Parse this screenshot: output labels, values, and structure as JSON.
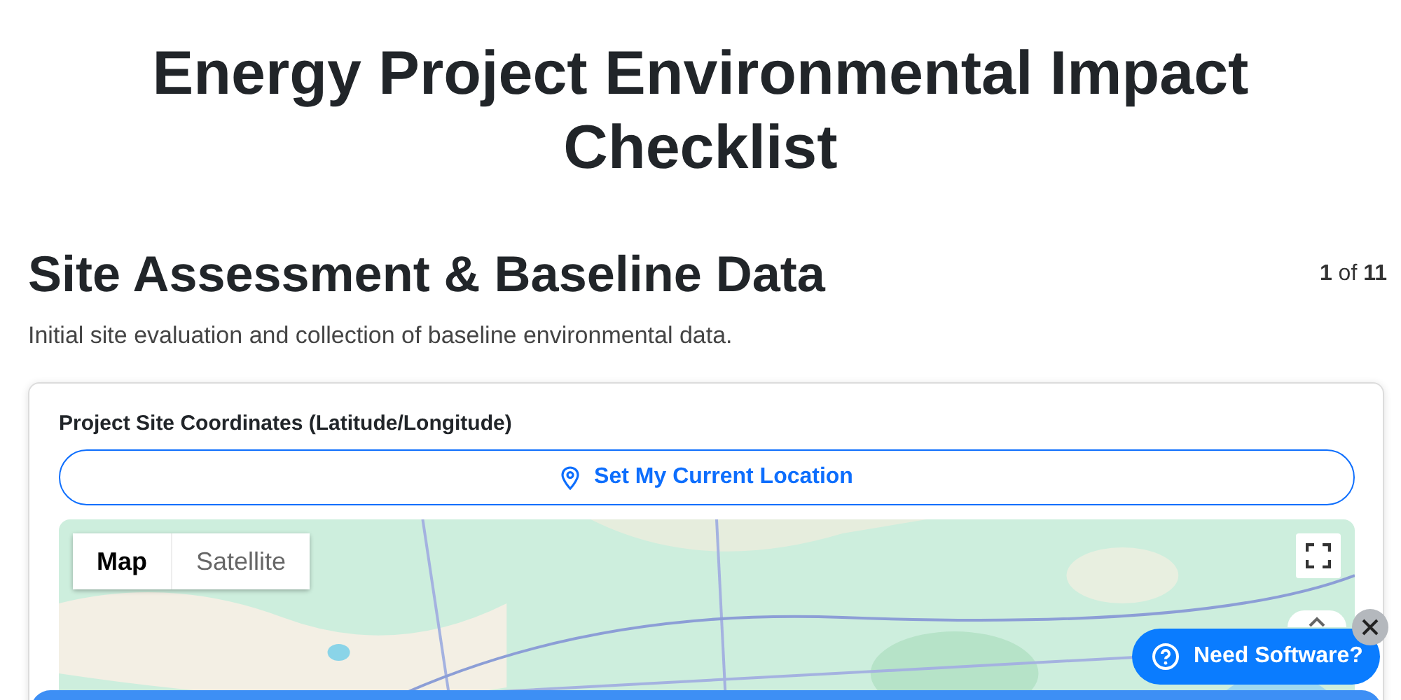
{
  "title": "Energy Project Environmental Impact Checklist",
  "section": {
    "title": "Site Assessment & Baseline Data",
    "progress": "**1** of **11**",
    "description": "Initial site evaluation and collection of baseline environmental data."
  },
  "card": {
    "label": "Project Site Coordinates (Latitude/Longitude)",
    "location_button": "Set My Current Location",
    "map": {
      "kind": "picture",
      "type_buttons": [
        {
          "label": "Map",
          "selected": true
        },
        {
          "label": "Satellite",
          "selected": false
        }
      ]
    }
  },
  "help_button": {
    "label": "Need Software?"
  }
}
